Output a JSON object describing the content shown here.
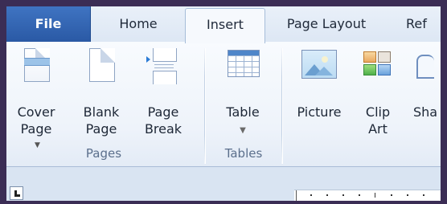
{
  "tabs": {
    "file": "File",
    "home": "Home",
    "insert": "Insert",
    "page_layout": "Page Layout",
    "references_partial": "Ref"
  },
  "ribbon": {
    "pages_group": {
      "label": "Pages",
      "cover_page": {
        "line1": "Cover",
        "line2": "Page",
        "has_dropdown": true,
        "icon": "cover-page-icon"
      },
      "blank_page": {
        "line1": "Blank",
        "line2": "Page",
        "icon": "blank-page-icon"
      },
      "page_break": {
        "line1": "Page",
        "line2": "Break",
        "icon": "page-break-icon"
      }
    },
    "tables_group": {
      "label": "Tables",
      "table": {
        "line1": "Table",
        "has_dropdown": true,
        "icon": "table-icon"
      }
    },
    "illustrations_group": {
      "picture": {
        "line1": "Picture",
        "icon": "picture-icon"
      },
      "clip_art": {
        "line1": "Clip",
        "line2": "Art",
        "icon": "clip-art-icon"
      },
      "shapes_partial": {
        "line1": "Sha",
        "icon": "shapes-icon"
      }
    }
  },
  "colors": {
    "file_tab": "#2a59a5",
    "frame_border": "#3b2d55",
    "group_label": "#5b6f8c"
  }
}
